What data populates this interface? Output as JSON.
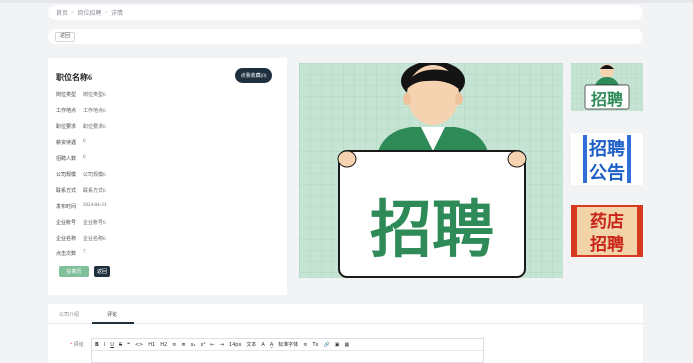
{
  "breadcrumb": {
    "home": "首页",
    "section": "岗位招聘",
    "current": "详情",
    "separator": ">"
  },
  "back_label": "返回",
  "job": {
    "title": "职位名称6",
    "collect_label": "点我收藏(0)",
    "fields": [
      {
        "label": "岗位类型",
        "value": "岗位类型6"
      },
      {
        "label": "工作地点",
        "value": "工作地点6"
      },
      {
        "label": "职位要求",
        "value": "职位要求6"
      },
      {
        "label": "薪资待遇",
        "value": "6"
      },
      {
        "label": "招聘人数",
        "value": "6"
      },
      {
        "label": "公司规模",
        "value": "公司规模6"
      },
      {
        "label": "联系方式",
        "value": "联系方式6"
      },
      {
        "label": "发布时间",
        "value": "2024-04-23"
      },
      {
        "label": "企业账号",
        "value": "企业账号6"
      },
      {
        "label": "企业名称",
        "value": "企业名称6"
      },
      {
        "label": "点击次数",
        "value": "7"
      }
    ],
    "apply_label": "投简历",
    "back_label": "返回"
  },
  "images": {
    "main_text": "招聘",
    "thumb1_text": "招聘",
    "thumb2_line1": "招聘",
    "thumb2_line2": "公告",
    "thumb3_line1": "药店",
    "thumb3_line2": "招聘"
  },
  "tabs": [
    {
      "label": "公司介绍"
    },
    {
      "label": "评论"
    }
  ],
  "comment": {
    "label": "评论",
    "required_mark": "*"
  },
  "toolbar": {
    "items": [
      "B",
      "I",
      "U",
      "S",
      "❝",
      "<>",
      "H1",
      "H2",
      "≡",
      "≣",
      "x₂",
      "x²",
      "⇤",
      "⇥",
      "14px",
      "文本",
      "A",
      "A̲",
      "标准字体",
      "≡",
      "Tx",
      "🔗",
      "▣",
      "▦"
    ]
  },
  "colors": {
    "accent": "#1e2f3e",
    "apply_green": "#7fbf9a",
    "poster_green": "#2e8b57",
    "poster_bg": "#bfe0cf",
    "poster_red": "#d63a1e"
  }
}
